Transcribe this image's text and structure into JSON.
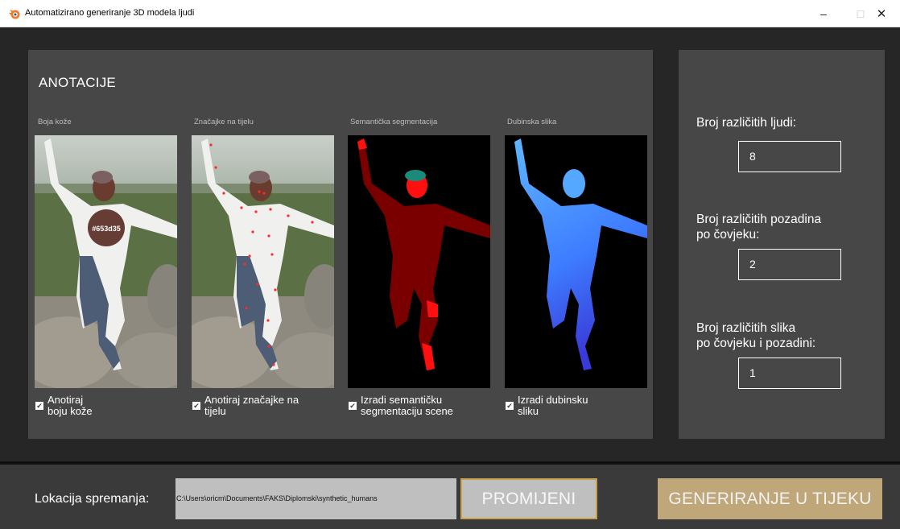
{
  "window": {
    "title": "Automatizirano generiranje 3D modela ljudi",
    "minimize_glyph": "–",
    "maximize_glyph": "□",
    "close_glyph": "✕",
    "icon": "blender-logo-icon"
  },
  "annotations": {
    "title": "ANOTACIJE",
    "previews": [
      {
        "label": "Boja kože",
        "checkbox_label": "Anotiraj boju kože",
        "checked": true,
        "overlay_text": "#653d35"
      },
      {
        "label": "Značajke na tijelu",
        "checkbox_label": "Anotiraj značajke na tijelu",
        "checked": true
      },
      {
        "label": "Semantička segmentacija",
        "checkbox_label": "Izradi semantičku segmentaciju scene",
        "checked": true
      },
      {
        "label": "Dubinska slika",
        "checkbox_label": "Izradi dubinsku sliku",
        "checked": true
      }
    ]
  },
  "settings": {
    "people_count_label": "Broj različitih ljudi:",
    "people_count_value": "8",
    "backgrounds_label_line1": "Broj različitih pozadina",
    "backgrounds_label_line2": "po čovjeku:",
    "backgrounds_value": "2",
    "images_label_line1": "Broj različitih slika",
    "images_label_line2": "po čovjeku i pozadini:",
    "images_value": "1"
  },
  "footer": {
    "location_label": "Lokacija spremanja:",
    "path": "C:\\Users\\oricm\\Documents\\FAKS\\Diplomski\\synthetic_humans",
    "change_button": "PROMIJENI",
    "generate_button": "GENERIRANJE U TIJEKU"
  },
  "colors": {
    "skin_swatch": "#653d35",
    "panel_bg": "#474747",
    "app_bg": "#262626",
    "change_border": "#c9a14a",
    "generate_bg": "#bfa77a",
    "segmentation_body": "#7a0000",
    "segmentation_parts": "#ff1010",
    "depth_body": "#3d8cff"
  }
}
